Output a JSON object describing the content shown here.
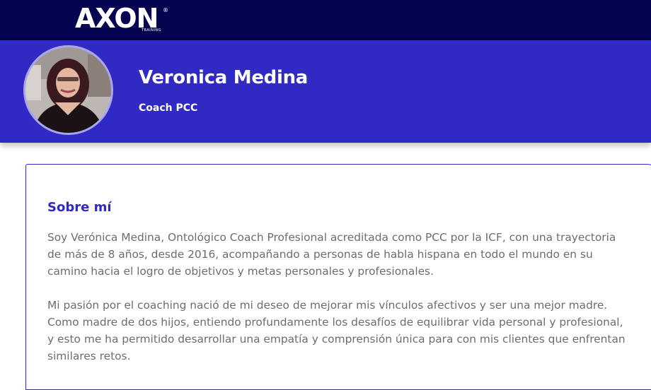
{
  "header": {
    "logo_text": "AXON",
    "logo_registered": "®",
    "logo_subtext": "TRAINING"
  },
  "profile": {
    "name": "Veronica Medina",
    "role": "Coach PCC",
    "avatar_icon": "coach-portrait"
  },
  "about": {
    "title": "Sobre mí",
    "paragraphs": [
      "Soy Verónica Medina, Ontológico Coach Profesional acreditada como PCC por la ICF, con una trayectoria de más de 8 años, desde 2016, acompañando a personas de habla hispana en todo el mundo en su camino hacia el logro de objetivos y metas personales y profesionales.",
      "Mi pasión por el coaching nació de mi deseo de mejorar mis vínculos afectivos y ser una mejor madre. Como madre de dos hijos, entiendo profundamente los desafíos de equilibrar vida personal y profesional, y esto me ha permitido desarrollar una empatía y comprensión única para con mis clientes que enfrentan similares retos."
    ]
  },
  "colors": {
    "topbar": "#050450",
    "banner": "#3129c4",
    "accent": "#3129c4",
    "body_text": "#6d6d6d"
  }
}
